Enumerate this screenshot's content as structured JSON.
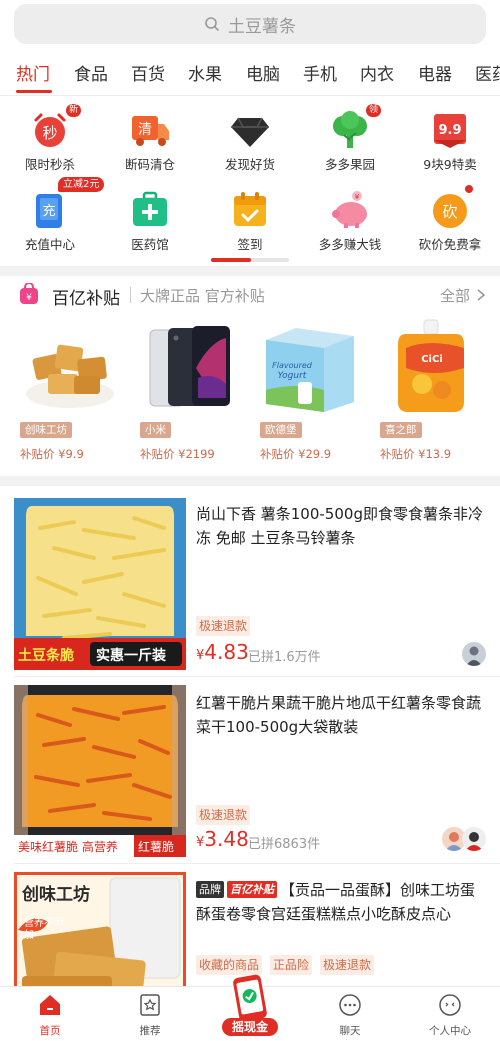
{
  "search": {
    "placeholder": "土豆薯条"
  },
  "categories": [
    "热门",
    "食品",
    "百货",
    "水果",
    "电脑",
    "手机",
    "内衣",
    "电器",
    "医药"
  ],
  "grid": [
    {
      "label": "限时秒杀",
      "icon": "flash-sale-clock-icon",
      "badge": "新"
    },
    {
      "label": "断码清仓",
      "icon": "clearance-truck-icon"
    },
    {
      "label": "发现好货",
      "icon": "diamond-icon"
    },
    {
      "label": "多多果园",
      "icon": "orchard-tree-icon",
      "badge": "领"
    },
    {
      "label": "9块9特卖",
      "icon": "nine-nine-icon"
    },
    {
      "label": "充值中心",
      "icon": "phone-recharge-icon",
      "badge": "立减2元"
    },
    {
      "label": "医药馆",
      "icon": "medicine-kit-icon"
    },
    {
      "label": "签到",
      "icon": "calendar-checkin-icon"
    },
    {
      "label": "多多赚大钱",
      "icon": "piggy-bank-icon"
    },
    {
      "label": "砍价免费拿",
      "icon": "bargain-icon"
    }
  ],
  "subsidy": {
    "title": "百亿补贴",
    "slogan": "大牌正品 官方补贴",
    "all": "全部",
    "products": [
      {
        "brand": "创味工坊",
        "price": "补贴价 ¥9.9"
      },
      {
        "brand": "小米",
        "price": "补贴价 ¥2199"
      },
      {
        "brand": "欧德堡",
        "price": "补贴价 ¥29.9"
      },
      {
        "brand": "喜之郎",
        "price": "补贴价 ¥13.9"
      }
    ]
  },
  "feed": [
    {
      "title": "尚山下香 薯条100-500g即食零食薯条非冷冻 免邮 土豆条马铃薯条",
      "tags": [
        "极速退款"
      ],
      "yen": "¥",
      "price": "4.83",
      "sold": "已拼1.6万件",
      "banner_left": "土豆条脆",
      "banner_right": "实惠一斤装"
    },
    {
      "title": "红薯干脆片果蔬干脆片地瓜干红薯条零食蔬菜干100-500g大袋散装",
      "tags": [
        "极速退款"
      ],
      "yen": "¥",
      "price": "3.48",
      "sold": "已拼6863件",
      "banner_left": "美味红薯脆 高营养",
      "banner_right": "红薯脆"
    },
    {
      "brand_label": "品牌",
      "subsidy_label": "百亿补贴",
      "title": "【贡品一品蛋酥】创味工坊蛋酥蛋卷零食宫廷蛋糕糕点小吃酥皮点心",
      "tags": [
        "收藏的商品",
        "正品险",
        "极速退款"
      ],
      "img_brand": "创味工坊",
      "img_badge": "营养不添加"
    }
  ],
  "tabbar": {
    "tabs": [
      "首页",
      "推荐",
      "聊天",
      "个人中心"
    ],
    "shake_label": "摇现金"
  },
  "colors": {
    "accent": "#e02e24",
    "tag_bg": "#fbece4",
    "subsidy_tag": "#d9a78e"
  }
}
